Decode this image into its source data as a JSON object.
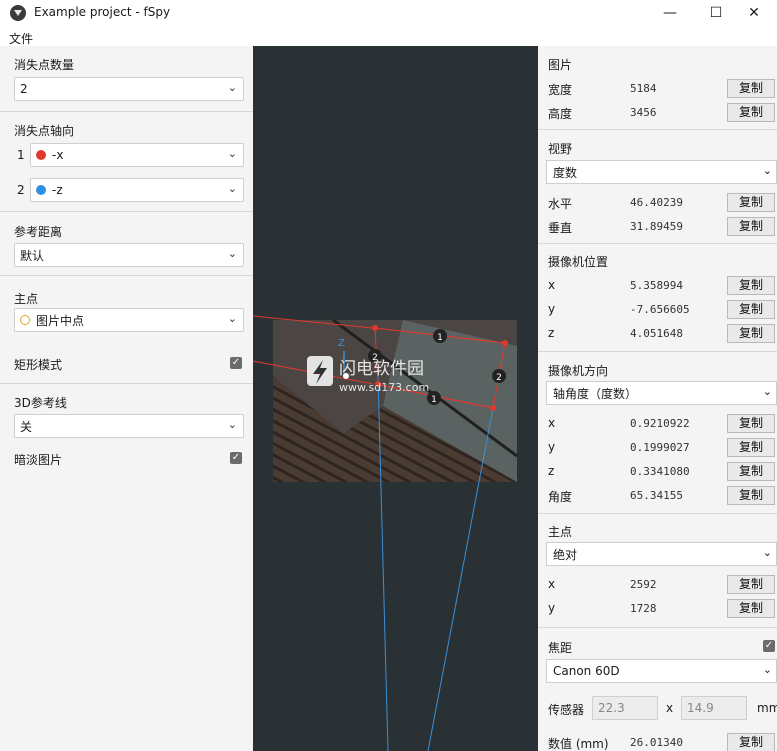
{
  "window": {
    "title": "Example project - fSpy",
    "minimize": "—",
    "maximize": "☐",
    "close": "✕"
  },
  "menu": {
    "file": "文件"
  },
  "left": {
    "vp_count": {
      "title": "消失点数量",
      "value": "2"
    },
    "vp_axes": {
      "title": "消失点轴向",
      "items": [
        {
          "index": "1",
          "value": "-x",
          "color": "#e0392b"
        },
        {
          "index": "2",
          "value": "-z",
          "color": "#2f8fe6"
        }
      ]
    },
    "ref_distance": {
      "title": "参考距离",
      "value": "默认"
    },
    "principal": {
      "title": "主点",
      "value": "图片中点"
    },
    "rect_mode": {
      "label": "矩形模式",
      "checked": true
    },
    "ref_3d": {
      "title": "3D参考线",
      "value": "关"
    },
    "dim_image": {
      "label": "暗淡图片",
      "checked": true
    }
  },
  "viewport": {
    "handle_labels": [
      "1",
      "2",
      "1",
      "2"
    ],
    "axis_label": "Z",
    "watermark_title": "闪电软件园",
    "watermark_url": "www.sd173.com"
  },
  "right": {
    "copy_label": "复制",
    "image": {
      "title": "图片",
      "rows": [
        {
          "label": "宽度",
          "value": "5184"
        },
        {
          "label": "高度",
          "value": "3456"
        }
      ]
    },
    "fov": {
      "title": "视野",
      "unit": "度数",
      "rows": [
        {
          "label": "水平",
          "value": "46.40239"
        },
        {
          "label": "垂直",
          "value": "31.89459"
        }
      ]
    },
    "cam_pos": {
      "title": "摄像机位置",
      "rows": [
        {
          "label": "x",
          "value": "5.358994"
        },
        {
          "label": "y",
          "value": "-7.656605"
        },
        {
          "label": "z",
          "value": "4.051648"
        }
      ]
    },
    "cam_orient": {
      "title": "摄像机方向",
      "mode": "轴角度（度数）",
      "rows": [
        {
          "label": "x",
          "value": "0.9210922"
        },
        {
          "label": "y",
          "value": "0.1999027"
        },
        {
          "label": "z",
          "value": "0.3341080"
        },
        {
          "label": "角度",
          "value": "65.34155"
        }
      ]
    },
    "principal": {
      "title": "主点",
      "mode": "绝对",
      "rows": [
        {
          "label": "x",
          "value": "2592"
        },
        {
          "label": "y",
          "value": "1728"
        }
      ]
    },
    "focal": {
      "title": "焦距",
      "checked": true,
      "camera": "Canon 60D",
      "sensor_label": "传感器",
      "sensor_w": "22.3",
      "sensor_sep": "x",
      "sensor_h": "14.9",
      "sensor_unit": "mm",
      "value_label": "数值 (mm)",
      "value": "26.01340"
    }
  }
}
